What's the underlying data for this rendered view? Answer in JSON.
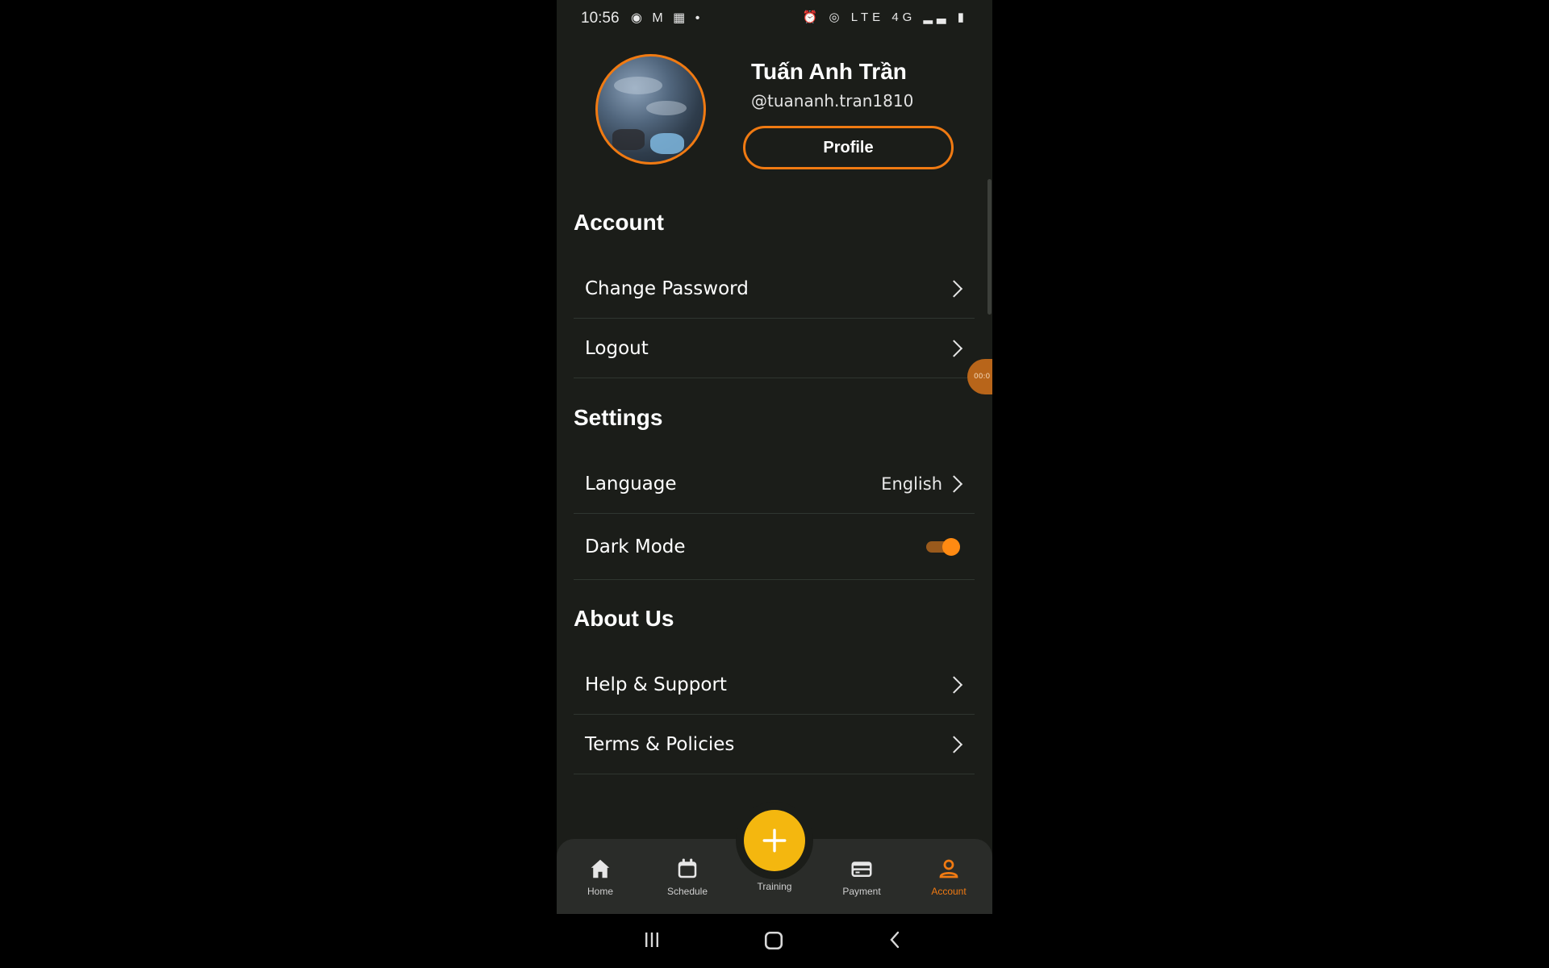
{
  "status_bar": {
    "time": "10:56",
    "left_icons": "◉ M ▦ •",
    "right_icons": "⏰ ◎ LTE 4G ▂▃ ▮"
  },
  "profile": {
    "name": "Tuấn Anh Trần",
    "handle": "@tuananh.tran1810",
    "button_label": "Profile"
  },
  "sections": {
    "account": {
      "title": "Account",
      "items": [
        {
          "label": "Change Password"
        },
        {
          "label": "Logout"
        }
      ]
    },
    "settings": {
      "title": "Settings",
      "language_label": "Language",
      "language_value": "English",
      "dark_mode_label": "Dark Mode",
      "dark_mode_on": true
    },
    "about": {
      "title": "About Us",
      "items": [
        {
          "label": "Help & Support"
        },
        {
          "label": "Terms & Policies"
        }
      ]
    }
  },
  "floating_indicator": "00:0",
  "bottom_nav": {
    "items": [
      {
        "label": "Home",
        "icon": "home-icon"
      },
      {
        "label": "Schedule",
        "icon": "calendar-icon"
      },
      {
        "label": "Training",
        "icon": "plus-icon"
      },
      {
        "label": "Payment",
        "icon": "card-icon"
      },
      {
        "label": "Account",
        "icon": "person-icon"
      }
    ],
    "active": "Account"
  },
  "colors": {
    "accent": "#f07a12",
    "fab": "#f4b70f",
    "background": "#1b1d19"
  }
}
